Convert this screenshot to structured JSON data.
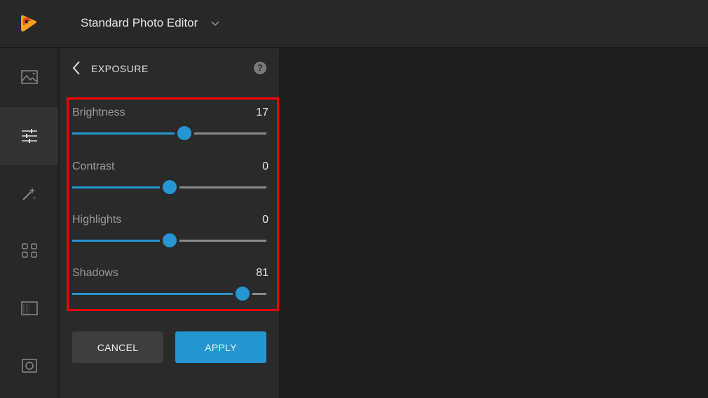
{
  "header": {
    "app_title": "Standard Photo Editor",
    "logo_icon": "app-logo-icon",
    "dropdown_icon": "chevron-down-icon"
  },
  "sidebar": {
    "items": [
      {
        "name": "image",
        "icon": "image-icon",
        "active": false
      },
      {
        "name": "adjust",
        "icon": "sliders-icon",
        "active": true
      },
      {
        "name": "effects",
        "icon": "magic-wand-icon",
        "active": false
      },
      {
        "name": "templates",
        "icon": "grid-icon",
        "active": false
      },
      {
        "name": "texture",
        "icon": "texture-icon",
        "active": false
      },
      {
        "name": "vignette",
        "icon": "vignette-icon",
        "active": false
      }
    ]
  },
  "panel": {
    "title": "EXPOSURE",
    "back_icon": "chevron-left-icon",
    "help_label": "?",
    "sliders": [
      {
        "label": "Brightness",
        "value": "17",
        "fraction": 0.585
      },
      {
        "label": "Contrast",
        "value": "0",
        "fraction": 0.5
      },
      {
        "label": "Highlights",
        "value": "0",
        "fraction": 0.5
      },
      {
        "label": "Shadows",
        "value": "81",
        "fraction": 0.905
      }
    ],
    "cancel_label": "CANCEL",
    "apply_label": "APPLY"
  },
  "colors": {
    "accent": "#2596d1",
    "highlight_border": "#ff0000"
  }
}
